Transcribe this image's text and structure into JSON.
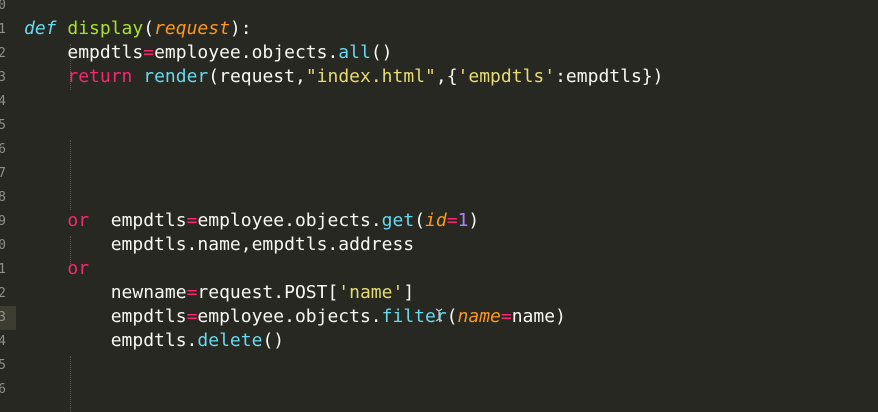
{
  "gutter": {
    "line_numbers": [
      "0",
      "1",
      "2",
      "3",
      "4",
      "5",
      "6",
      "7",
      "8",
      "9",
      "0",
      "1",
      "2",
      "3",
      "4",
      "5",
      "6"
    ]
  },
  "code": {
    "line1": {
      "def": "def",
      "space": " ",
      "fn_name": "display",
      "open": "(",
      "param": "request",
      "close": "):"
    },
    "line2": {
      "indent": "    ",
      "var": "empdtls",
      "eq": "=",
      "obj": "employee.objects.",
      "method": "all",
      "call": "()"
    },
    "line3": {
      "indent": "    ",
      "kw": "return",
      "space": " ",
      "fn": "render",
      "open": "(request,",
      "str1": "\"index.html\"",
      "mid": ",{",
      "str2": "'empdtls'",
      "tail": ":empdtls})"
    },
    "line8": {
      "indent": "    ",
      "kw": "or",
      "gap": "  ",
      "var": "empdtls",
      "eq": "=",
      "obj": "employee.objects.",
      "method": "get",
      "open": "(",
      "param": "id",
      "eq2": "=",
      "num": "1",
      "close": ")"
    },
    "line9": {
      "text": "        empdtls.name,empdtls.address"
    },
    "line10": {
      "indent": "    ",
      "kw": "or"
    },
    "line11": {
      "indent": "        ",
      "var": "newname",
      "eq": "=",
      "obj": "request.POST[",
      "str": "'name'",
      "close": "]"
    },
    "line12": {
      "indent": "        ",
      "var": "empdtls",
      "eq": "=",
      "obj": "employee.objects.",
      "method": "filter",
      "open": "(",
      "param": "name",
      "eq2": "=",
      "arg": "name",
      "close": ")"
    },
    "line13": {
      "indent": "        ",
      "obj": "empdtls.",
      "method": "delete",
      "call": "()"
    }
  },
  "colors": {
    "background": "#272822",
    "foreground": "#f8f8f2",
    "keyword": "#f92672",
    "function": "#a6e22e",
    "builtin": "#66d9ef",
    "string": "#e6db74",
    "parameter": "#fd971f",
    "number": "#ae81ff"
  }
}
